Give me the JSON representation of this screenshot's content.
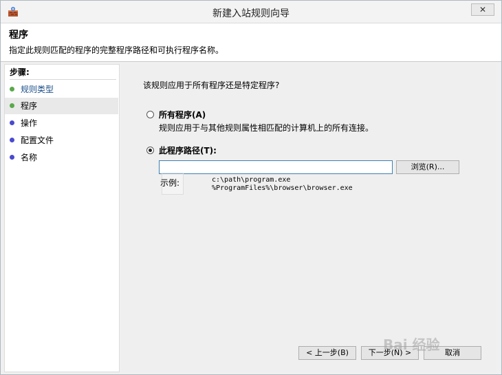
{
  "window": {
    "title": "新建入站规则向导",
    "close_label": "✕"
  },
  "header": {
    "title": "程序",
    "description": "指定此规则匹配的程序的完整程序路径和可执行程序名称。"
  },
  "steps": {
    "heading": "步骤:",
    "items": [
      {
        "label": "规则类型",
        "status": "done"
      },
      {
        "label": "程序",
        "status": "current"
      },
      {
        "label": "操作",
        "status": "pending"
      },
      {
        "label": "配置文件",
        "status": "pending"
      },
      {
        "label": "名称",
        "status": "pending"
      }
    ]
  },
  "content": {
    "question": "该规则应用于所有程序还是特定程序?",
    "option_all": {
      "label": "所有程序(A)",
      "description": "规则应用于与其他规则属性相匹配的计算机上的所有连接。"
    },
    "option_path": {
      "label": "此程序路径(T):"
    },
    "path_value": "",
    "browse_label": "浏览(R)...",
    "example_label": "示例:",
    "example_lines": [
      "c:\\path\\program.exe",
      "%ProgramFiles%\\browser\\browser.exe"
    ]
  },
  "footer": {
    "back": "< 上一步(B)",
    "next": "下一步(N) >",
    "cancel": "取消"
  },
  "watermark": "Bai 经验",
  "colors": {
    "done_dot": "#5aa84a",
    "pending_dot": "#4a4ad0",
    "link_text": "#1b4f8a"
  }
}
